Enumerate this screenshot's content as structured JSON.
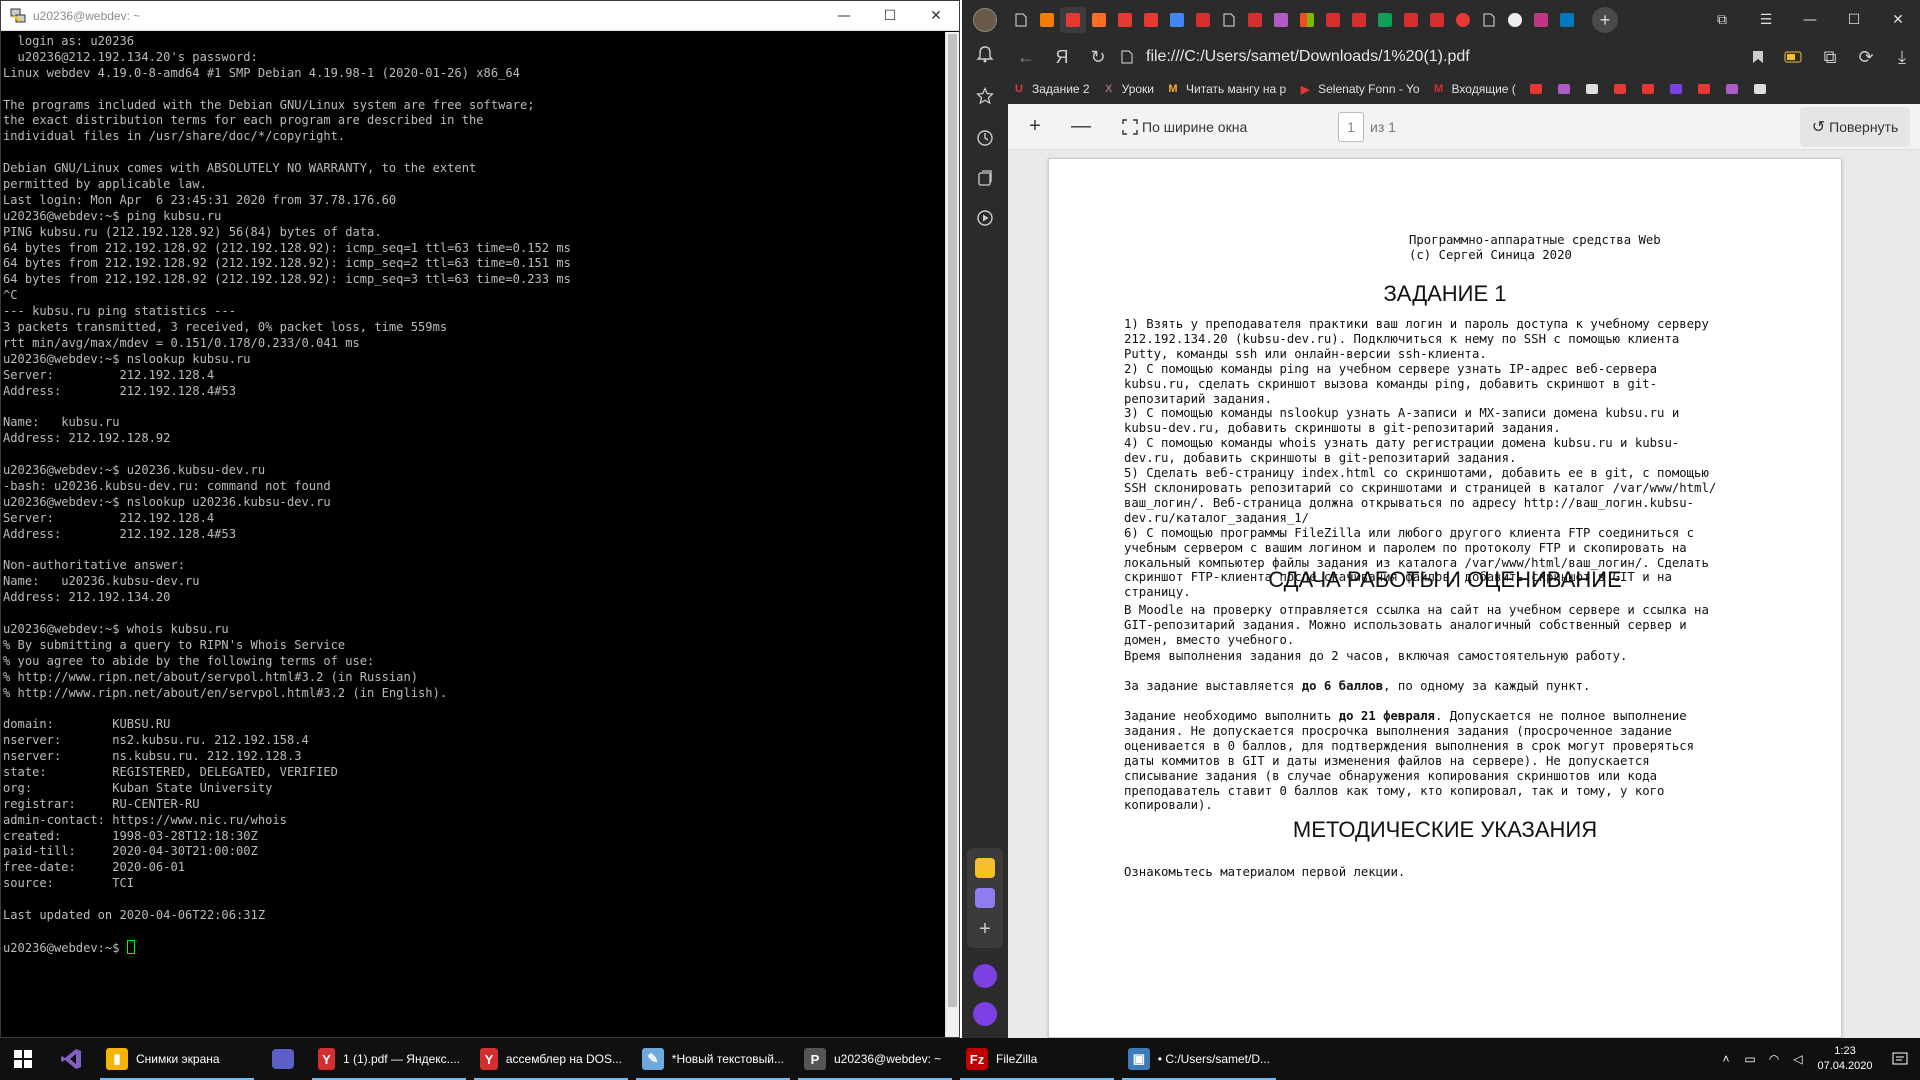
{
  "putty": {
    "title": "u20236@webdev: ~",
    "minimize": "—",
    "maximize": "☐",
    "close": "✕",
    "lines": [
      "  login as: u20236",
      "  u20236@212.192.134.20's password:",
      "Linux webdev 4.19.0-8-amd64 #1 SMP Debian 4.19.98-1 (2020-01-26) x86_64",
      "",
      "The programs included with the Debian GNU/Linux system are free software;",
      "the exact distribution terms for each program are described in the",
      "individual files in /usr/share/doc/*/copyright.",
      "",
      "Debian GNU/Linux comes with ABSOLUTELY NO WARRANTY, to the extent",
      "permitted by applicable law.",
      "Last login: Mon Apr  6 23:45:31 2020 from 37.78.176.60",
      "u20236@webdev:~$ ping kubsu.ru",
      "PING kubsu.ru (212.192.128.92) 56(84) bytes of data.",
      "64 bytes from 212.192.128.92 (212.192.128.92): icmp_seq=1 ttl=63 time=0.152 ms",
      "64 bytes from 212.192.128.92 (212.192.128.92): icmp_seq=2 ttl=63 time=0.151 ms",
      "64 bytes from 212.192.128.92 (212.192.128.92): icmp_seq=3 ttl=63 time=0.233 ms",
      "^C",
      "--- kubsu.ru ping statistics ---",
      "3 packets transmitted, 3 received, 0% packet loss, time 559ms",
      "rtt min/avg/max/mdev = 0.151/0.178/0.233/0.041 ms",
      "u20236@webdev:~$ nslookup kubsu.ru",
      "Server:         212.192.128.4",
      "Address:        212.192.128.4#53",
      "",
      "Name:   kubsu.ru",
      "Address: 212.192.128.92",
      "",
      "u20236@webdev:~$ u20236.kubsu-dev.ru",
      "-bash: u20236.kubsu-dev.ru: command not found",
      "u20236@webdev:~$ nslookup u20236.kubsu-dev.ru",
      "Server:         212.192.128.4",
      "Address:        212.192.128.4#53",
      "",
      "Non-authoritative answer:",
      "Name:   u20236.kubsu-dev.ru",
      "Address: 212.192.134.20",
      "",
      "u20236@webdev:~$ whois kubsu.ru",
      "% By submitting a query to RIPN's Whois Service",
      "% you agree to abide by the following terms of use:",
      "% http://www.ripn.net/about/servpol.html#3.2 (in Russian)",
      "% http://www.ripn.net/about/en/servpol.html#3.2 (in English).",
      "",
      "domain:        KUBSU.RU",
      "nserver:       ns2.kubsu.ru. 212.192.158.4",
      "nserver:       ns.kubsu.ru. 212.192.128.3",
      "state:         REGISTERED, DELEGATED, VERIFIED",
      "org:           Kuban State University",
      "registrar:     RU-CENTER-RU",
      "admin-contact: https://www.nic.ru/whois",
      "created:       1998-03-28T12:18:30Z",
      "paid-till:     2020-04-30T21:00:00Z",
      "free-date:     2020-06-01",
      "source:        TCI",
      "",
      "Last updated on 2020-04-06T22:06:31Z",
      ""
    ],
    "prompt": "u20236@webdev:~$ "
  },
  "browser": {
    "url": "file:///C:/Users/samet/Downloads/1%20(1).pdf",
    "bookmarks": [
      {
        "label": "Задание 2",
        "color": "#e53935",
        "glyph": "U"
      },
      {
        "label": "Уроки",
        "color": "#8d6e63",
        "glyph": "X"
      },
      {
        "label": "Читать мангу на р",
        "color": "#f9a825",
        "glyph": "M"
      },
      {
        "label": "Selenaty Fonn - Yo",
        "color": "#e53935",
        "glyph": "▶"
      },
      {
        "label": "Входящие (",
        "color": "#d32f2f",
        "glyph": "M"
      }
    ],
    "pdf_toolbar": {
      "zoom_in": "+",
      "zoom_out": "—",
      "fit_width": "По ширине окна",
      "page_current": "1",
      "page_of": "из 1",
      "rotate": "Повернуть"
    }
  },
  "pdf": {
    "header_line1": "Программно-аппаратные средства Web",
    "header_line2": "(c) Сергей Синица 2020",
    "h_task": "ЗАДАНИЕ 1",
    "task_items": [
      "1) Взять у преподавателя практики ваш логин и пароль доступа к учебному серверу",
      "212.192.134.20 (kubsu-dev.ru).  Подключиться к нему по SSH с помощью клиента",
      "Putty, команды ssh или онлайн-версии ssh-клиента.",
      "2) С помощью команды ping на учебном сервере узнать IP-адрес веб-сервера",
      "kubsu.ru, сделать скриншот вызова команды ping, добавить скриншот в git-",
      "репозитарий задания.",
      "3) С помощью команды nslookup узнать A-записи и MX-записи домена kubsu.ru и",
      "kubsu-dev.ru, добавить скриншоты в git-репозитарий задания.",
      "4) С помощью команды whois узнать дату регистрации домена kubsu.ru и kubsu-",
      "dev.ru, добавить скриншоты в git-репозитарий задания.",
      "5) Сделать веб-страницу  index.html со скриншотами, добавить ее в git, с помощью",
      "SSH склонировать репозитарий со скриншотами и страницей в каталог /var/www/html/",
      "ваш_логин/. Веб-страница должна открываться по адресу http://ваш_логин.kubsu-",
      "dev.ru/каталог_задания_1/",
      "6) С помощью программы FileZilla или любого другого клиента FTP соединиться с",
      "учебным сервером с вашим логином и паролем по протоколу FTP и скопировать на",
      "локальный компьютер файлы задания из каталога /var/www/html/ваш_логин/. Сделать",
      "скриншот FTP-клиента после скачивания файлов, добавить скриншот в GIT и на",
      "страницу."
    ],
    "h_grading": "СДАЧА РАБОТЫ И ОЦЕНИВАНИЕ",
    "grading_p1": [
      "В Moodle на проверку отправляется ссылка на сайт на учебном сервере и ссылка на",
      "GIT-репозитарий задания. Можно использовать аналогичный собственный сервер и",
      "домен, вместо учебного."
    ],
    "grading_p2": "Время выполнения задания до 2 часов, включая самостоятельную работу.",
    "grading_p3_a": "За задание выставляется ",
    "grading_p3_b": "до 6 баллов",
    "grading_p3_c": ", по одному за каждый пункт.",
    "grading_p4_a": "Задание необходимо выполнить ",
    "grading_p4_b": "до 21 февраля",
    "grading_p4_c": ". Допускается не полное выполнение",
    "grading_p4_rest": [
      "задания. Не допускается просрочка выполнения задания (просроченное задание",
      "оценивается в 0 баллов, для подтверждения выполнения в срок могут проверяться",
      "даты коммитов в GIT и даты изменения файлов на сервере). Не допускается",
      "списывание задания (в случае обнаружения копирования скриншотов или кода",
      "преподаватель ставит 0 баллов как тому, кто копировал, так и тому, у кого",
      "копировали)."
    ],
    "h_method": "МЕТОДИЧЕСКИЕ УКАЗАНИЯ",
    "method_p": "Ознакомьтесь материалом первой лекции."
  },
  "taskbar": {
    "items": [
      {
        "label": "Снимки экрана",
        "color": "#f4b400",
        "glyph": "▮"
      },
      {
        "label": "1 (1).pdf — Яндекс....",
        "color": "#d32f2f",
        "glyph": "Y"
      },
      {
        "label": "ассемблер на DOS...",
        "color": "#d32f2f",
        "glyph": "Y"
      },
      {
        "label": "*Новый текстовый...",
        "color": "#6fa8dc",
        "glyph": "✎"
      },
      {
        "label": "u20236@webdev: ~",
        "color": "#555",
        "glyph": "P"
      },
      {
        "label": "FileZilla",
        "color": "#bf0000",
        "glyph": "Fz"
      },
      {
        "label": "• C:/Users/samet/D...",
        "color": "#3d7ab8",
        "glyph": "▣"
      }
    ],
    "time": "1:23",
    "date": "07.04.2020"
  }
}
